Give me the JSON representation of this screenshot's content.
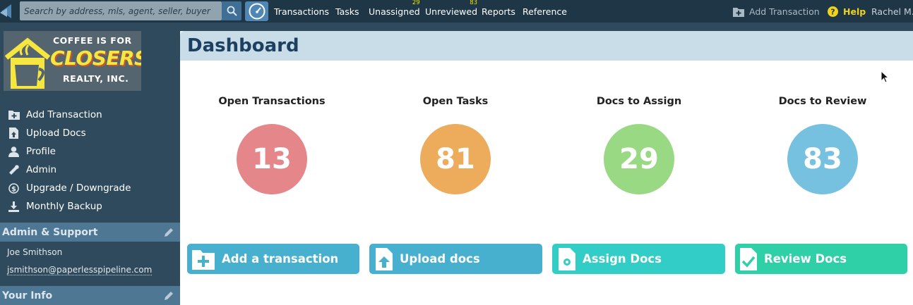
{
  "topbar": {
    "search_placeholder": "Search by address, mls, agent, seller, buyer",
    "nav": [
      {
        "label": "Transactions",
        "badge": ""
      },
      {
        "label": "Tasks",
        "badge": ""
      },
      {
        "label": "Unassigned",
        "badge": "29"
      },
      {
        "label": "Unreviewed",
        "badge": "83"
      },
      {
        "label": "Reports",
        "badge": ""
      },
      {
        "label": "Reference",
        "badge": ""
      }
    ],
    "add_transaction": "Add Transaction",
    "help": "Help",
    "user": "Rachel M."
  },
  "sidebar": {
    "brand": {
      "line1": "COFFEE IS FOR",
      "line2": "CLOSERS",
      "line3": "REALTY, INC."
    },
    "menu": [
      {
        "label": "Add Transaction",
        "icon": "folder-plus-icon"
      },
      {
        "label": "Upload Docs",
        "icon": "upload-doc-icon"
      },
      {
        "label": "Profile",
        "icon": "person-icon"
      },
      {
        "label": "Admin",
        "icon": "wrench-icon"
      },
      {
        "label": "Upgrade / Downgrade",
        "icon": "dollar-icon"
      },
      {
        "label": "Monthly Backup",
        "icon": "download-icon"
      }
    ],
    "admin_support": {
      "title": "Admin & Support",
      "name": "Joe Smithson",
      "email": "jsmithson@paperlesspipeline.com"
    },
    "your_info": {
      "title": "Your Info"
    }
  },
  "main": {
    "title": "Dashboard",
    "stats": [
      {
        "label": "Open Transactions",
        "value": "13",
        "color": "#e5868a"
      },
      {
        "label": "Open Tasks",
        "value": "81",
        "color": "#ecac5c"
      },
      {
        "label": "Docs to Assign",
        "value": "29",
        "color": "#9ad983"
      },
      {
        "label": "Docs to Review",
        "value": "83",
        "color": "#76c1df"
      }
    ],
    "actions": [
      {
        "label": "Add a transaction",
        "color": "#48b0cf"
      },
      {
        "label": "Upload docs",
        "color": "#48b0cf"
      },
      {
        "label": "Assign Docs",
        "color": "#31cdc6"
      },
      {
        "label": "Review Docs",
        "color": "#2fd0a7"
      }
    ]
  }
}
